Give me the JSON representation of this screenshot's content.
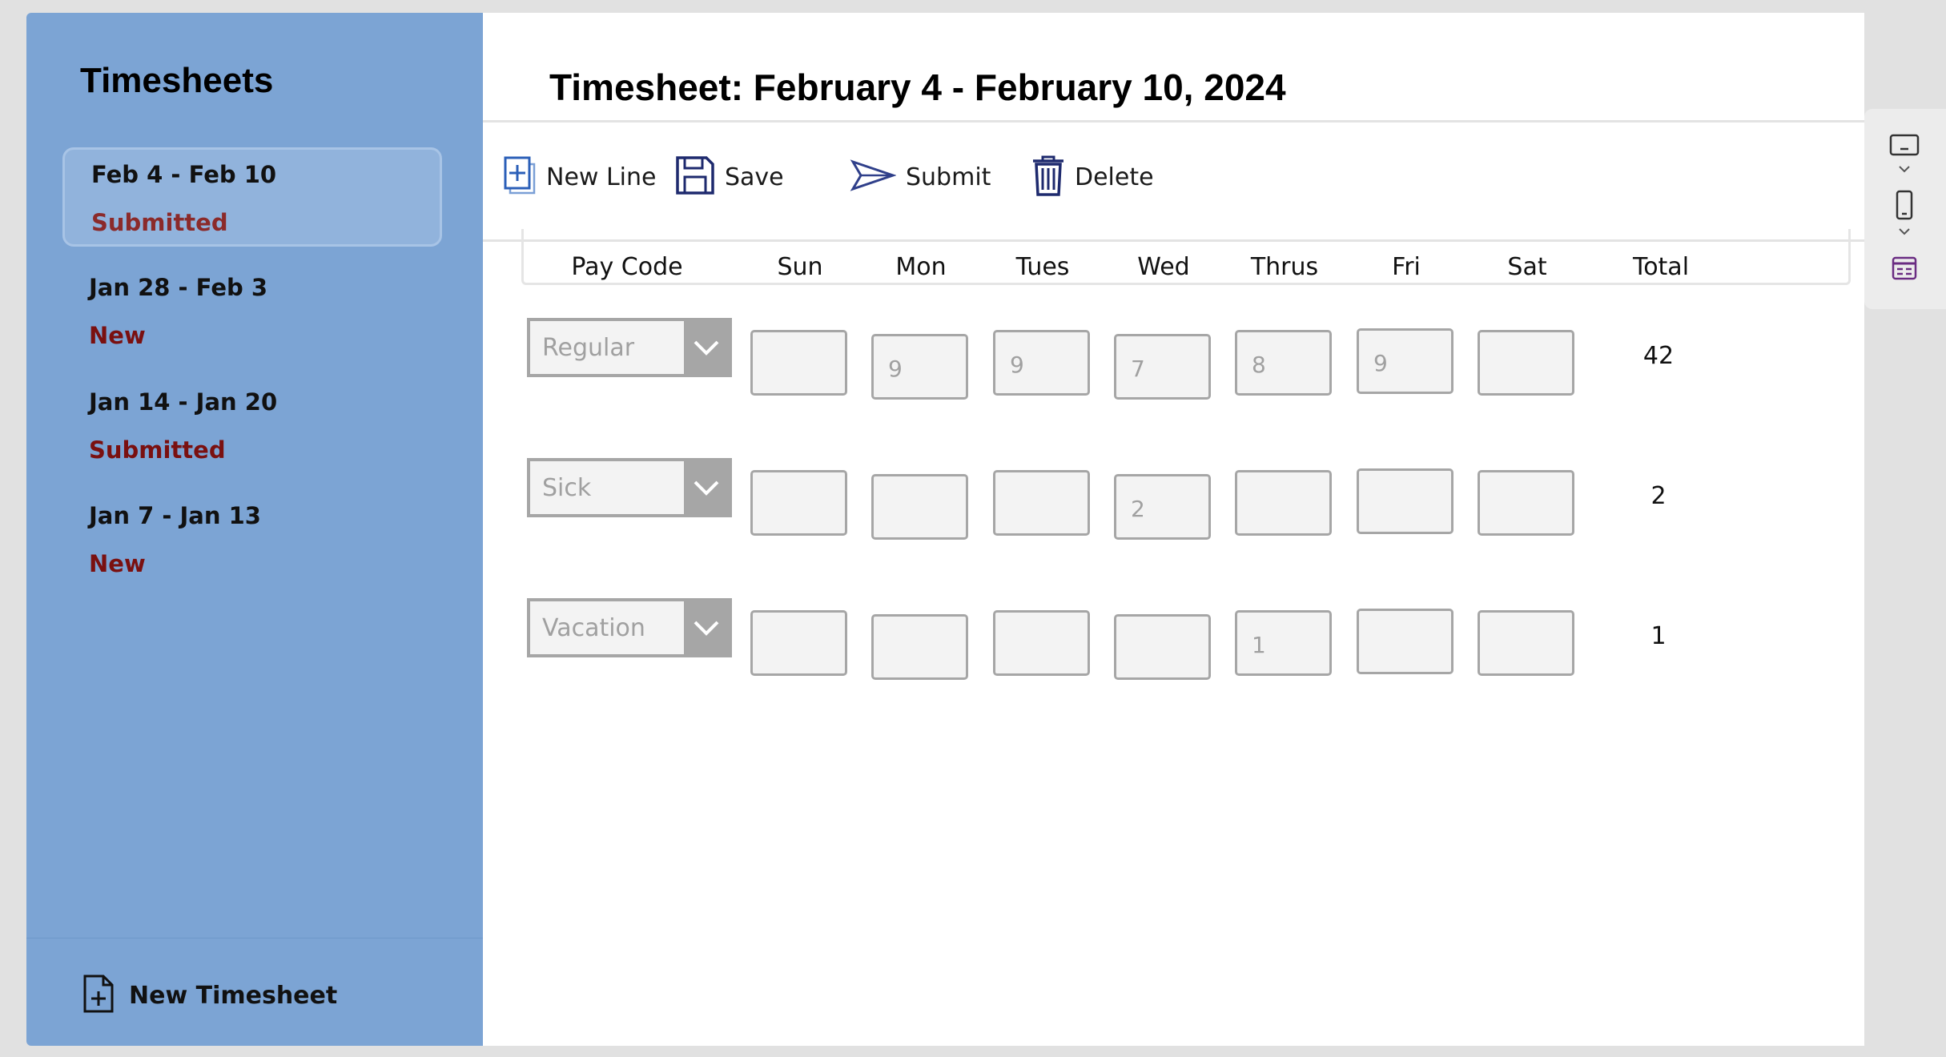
{
  "sidebar": {
    "title": "Timesheets",
    "items": [
      {
        "range": "Feb 4 - Feb 10",
        "status": "Submitted",
        "selected": true
      },
      {
        "range": "Jan 28 - Feb 3",
        "status": "New"
      },
      {
        "range": "Jan 14 - Jan 20",
        "status": "Submitted"
      },
      {
        "range": "Jan 7 - Jan 13",
        "status": "New"
      }
    ],
    "new_timesheet_label": "New Timesheet"
  },
  "main": {
    "title": "Timesheet: February 4 - February 10, 2024",
    "toolbar": {
      "new_line": "New Line",
      "save": "Save",
      "submit": "Submit",
      "delete": "Delete"
    },
    "columns": [
      "Pay Code",
      "Sun",
      "Mon",
      "Tues",
      "Wed",
      "Thrus",
      "Fri",
      "Sat",
      "Total"
    ],
    "rows": [
      {
        "pay_code": "Regular",
        "hours": [
          "",
          "9",
          "9",
          "7",
          "8",
          "9",
          ""
        ],
        "total": "42"
      },
      {
        "pay_code": "Sick",
        "hours": [
          "",
          "",
          "",
          "2",
          "",
          "",
          ""
        ],
        "total": "2"
      },
      {
        "pay_code": "Vacation",
        "hours": [
          "",
          "",
          "",
          "",
          "1",
          "",
          ""
        ],
        "total": "1"
      }
    ]
  },
  "colors": {
    "sidebar_bg": "#7ca4d4",
    "status_text": "#7a1010",
    "icon_navy": "#1e2a6e",
    "input_border": "#a6a6a6"
  },
  "icons": [
    "new-line-icon",
    "save-icon",
    "submit-icon",
    "delete-icon",
    "new-file-icon",
    "chevron-down-icon",
    "tablet-icon",
    "phone-icon",
    "form-icon"
  ]
}
